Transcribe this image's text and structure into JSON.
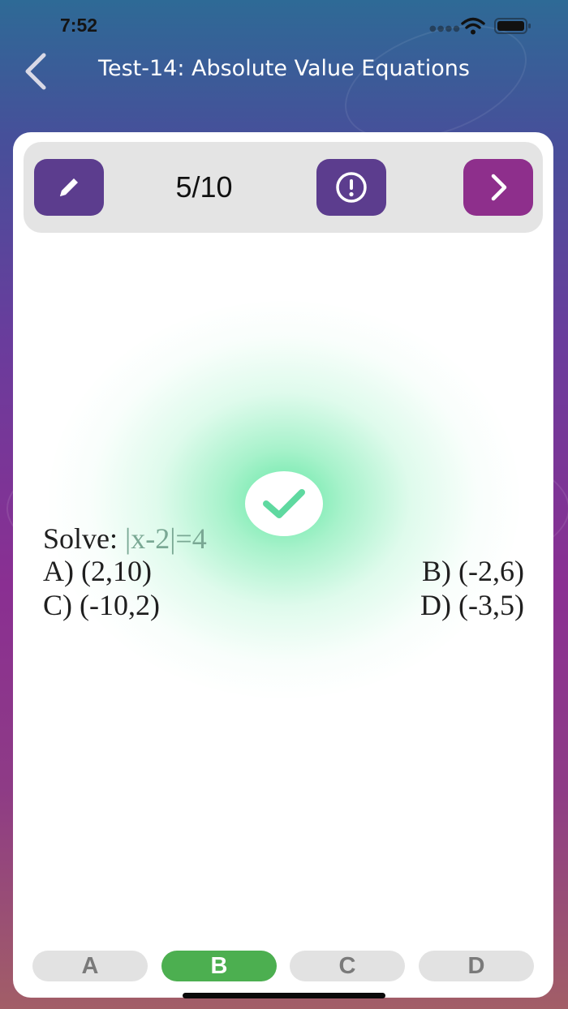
{
  "status_bar": {
    "time": "7:52",
    "signal_icon": "signal-dots-icon",
    "wifi_icon": "wifi-icon",
    "battery_icon": "battery-icon"
  },
  "header": {
    "back_icon": "chevron-left-icon",
    "title": "Test-14: Absolute Value Equations"
  },
  "toolbar": {
    "edit_icon": "pencil-icon",
    "counter": "5/10",
    "report_icon": "exclamation-circle-icon",
    "next_icon": "chevron-right-icon"
  },
  "feedback": {
    "icon": "checkmark-icon",
    "state": "correct",
    "glow_color": "#5ce6a0"
  },
  "question": {
    "prompt": "Solve: ",
    "equation": "|x-2|=4",
    "options": {
      "a": "A) (2,10)",
      "b": "B) (-2,6)",
      "c": "C) (-10,2)",
      "d": "D) (-3,5)"
    }
  },
  "answers": {
    "labels": [
      "A",
      "B",
      "C",
      "D"
    ],
    "selected": "B",
    "selected_color": "#4caf50",
    "default_color": "#e2e2e2"
  },
  "colors": {
    "button_purple": "#5c3d8e",
    "button_magenta": "#8e2f8c"
  }
}
